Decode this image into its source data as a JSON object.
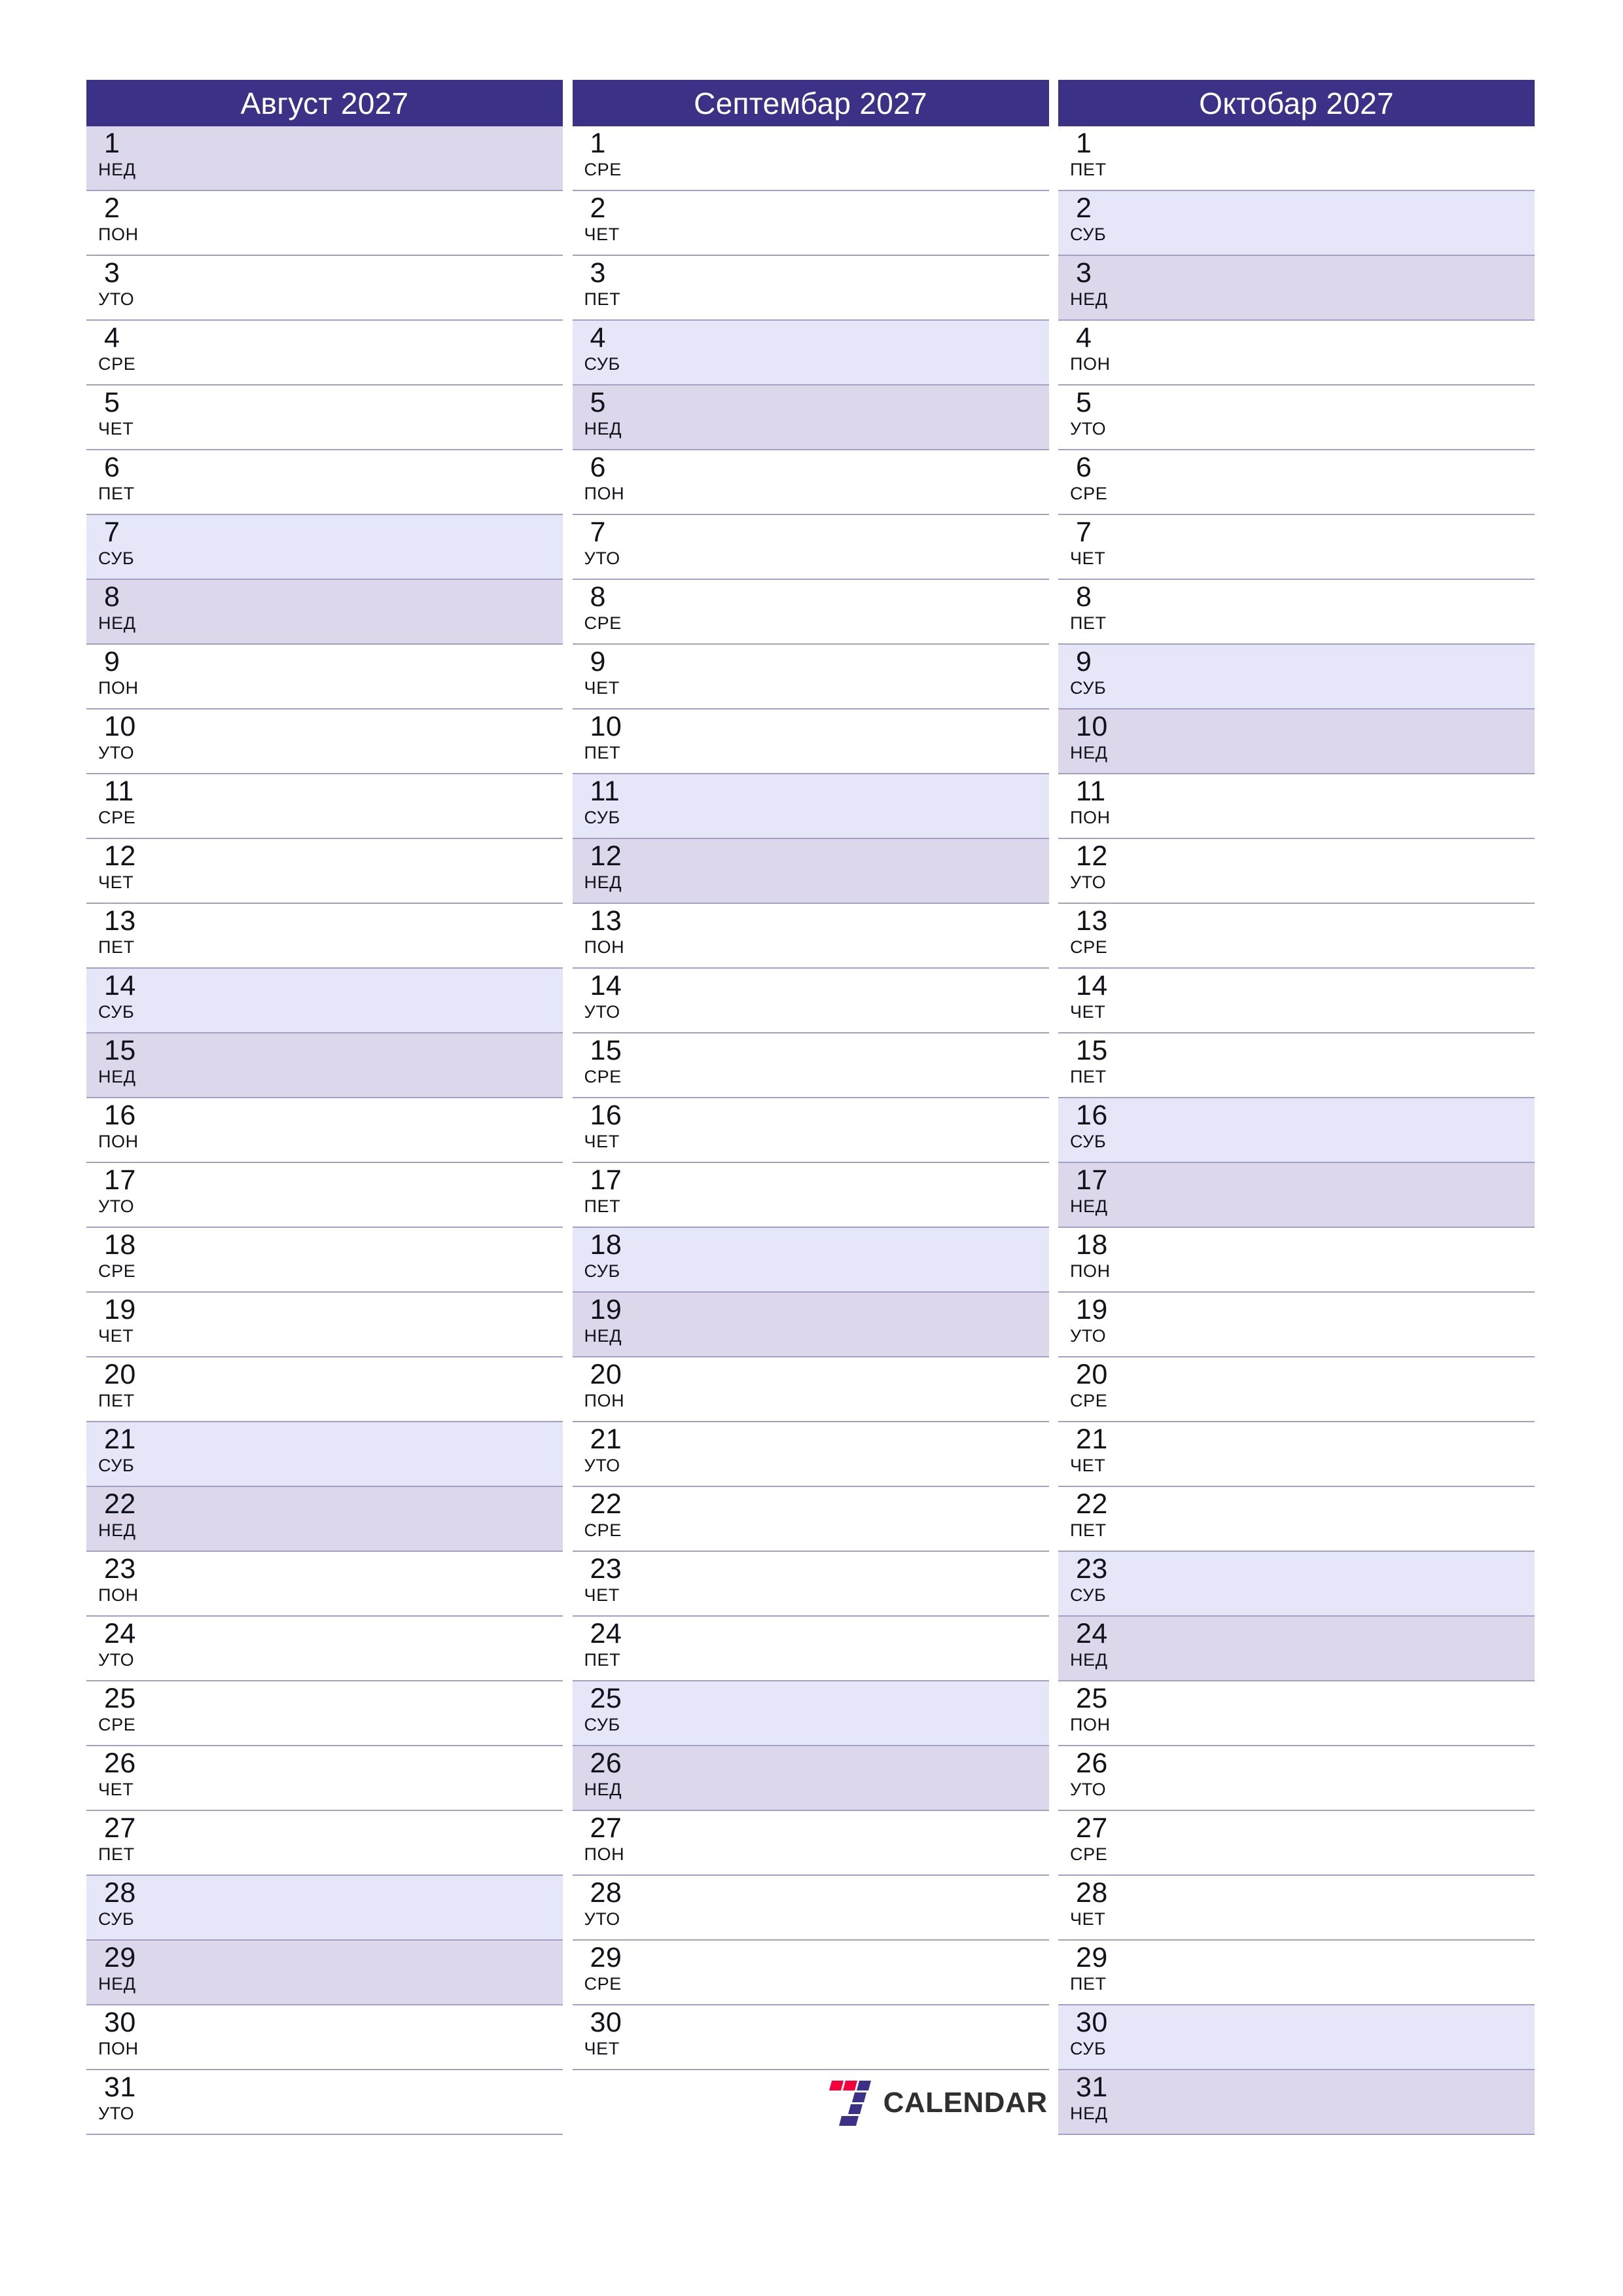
{
  "colors": {
    "header_bg": "#3b3287",
    "header_text": "#ffffff",
    "saturday_bg": "#e5e7f8",
    "sunday_bg": "#dcd7ea",
    "row_line": "#a3a0c4",
    "logo_red": "#f5003c",
    "logo_purple": "#3b3287",
    "logo_text": "#2f2f2f",
    "page_bg": "#ffffff"
  },
  "brand": {
    "name": "CALENDAR",
    "mark": "seven-logo-icon"
  },
  "weekday_names": {
    "mon": "ПОН",
    "tue": "УТО",
    "wed": "СРЕ",
    "thu": "ЧЕТ",
    "fri": "ПЕТ",
    "sat": "СУБ",
    "sun": "НЕД"
  },
  "months": [
    {
      "title": "Август 2027",
      "month_name": "Август",
      "year": "2027",
      "days": [
        {
          "n": "1",
          "wd": "НЕД",
          "type": "sun"
        },
        {
          "n": "2",
          "wd": "ПОН",
          "type": "wd"
        },
        {
          "n": "3",
          "wd": "УТО",
          "type": "wd"
        },
        {
          "n": "4",
          "wd": "СРЕ",
          "type": "wd"
        },
        {
          "n": "5",
          "wd": "ЧЕТ",
          "type": "wd"
        },
        {
          "n": "6",
          "wd": "ПЕТ",
          "type": "wd"
        },
        {
          "n": "7",
          "wd": "СУБ",
          "type": "sat"
        },
        {
          "n": "8",
          "wd": "НЕД",
          "type": "sun"
        },
        {
          "n": "9",
          "wd": "ПОН",
          "type": "wd"
        },
        {
          "n": "10",
          "wd": "УТО",
          "type": "wd"
        },
        {
          "n": "11",
          "wd": "СРЕ",
          "type": "wd"
        },
        {
          "n": "12",
          "wd": "ЧЕТ",
          "type": "wd"
        },
        {
          "n": "13",
          "wd": "ПЕТ",
          "type": "wd"
        },
        {
          "n": "14",
          "wd": "СУБ",
          "type": "sat"
        },
        {
          "n": "15",
          "wd": "НЕД",
          "type": "sun"
        },
        {
          "n": "16",
          "wd": "ПОН",
          "type": "wd"
        },
        {
          "n": "17",
          "wd": "УТО",
          "type": "wd"
        },
        {
          "n": "18",
          "wd": "СРЕ",
          "type": "wd"
        },
        {
          "n": "19",
          "wd": "ЧЕТ",
          "type": "wd"
        },
        {
          "n": "20",
          "wd": "ПЕТ",
          "type": "wd"
        },
        {
          "n": "21",
          "wd": "СУБ",
          "type": "sat"
        },
        {
          "n": "22",
          "wd": "НЕД",
          "type": "sun"
        },
        {
          "n": "23",
          "wd": "ПОН",
          "type": "wd"
        },
        {
          "n": "24",
          "wd": "УТО",
          "type": "wd"
        },
        {
          "n": "25",
          "wd": "СРЕ",
          "type": "wd"
        },
        {
          "n": "26",
          "wd": "ЧЕТ",
          "type": "wd"
        },
        {
          "n": "27",
          "wd": "ПЕТ",
          "type": "wd"
        },
        {
          "n": "28",
          "wd": "СУБ",
          "type": "sat"
        },
        {
          "n": "29",
          "wd": "НЕД",
          "type": "sun"
        },
        {
          "n": "30",
          "wd": "ПОН",
          "type": "wd"
        },
        {
          "n": "31",
          "wd": "УТО",
          "type": "wd"
        }
      ]
    },
    {
      "title": "Септембар 2027",
      "month_name": "Септембар",
      "year": "2027",
      "days": [
        {
          "n": "1",
          "wd": "СРЕ",
          "type": "wd"
        },
        {
          "n": "2",
          "wd": "ЧЕТ",
          "type": "wd"
        },
        {
          "n": "3",
          "wd": "ПЕТ",
          "type": "wd"
        },
        {
          "n": "4",
          "wd": "СУБ",
          "type": "sat"
        },
        {
          "n": "5",
          "wd": "НЕД",
          "type": "sun"
        },
        {
          "n": "6",
          "wd": "ПОН",
          "type": "wd"
        },
        {
          "n": "7",
          "wd": "УТО",
          "type": "wd"
        },
        {
          "n": "8",
          "wd": "СРЕ",
          "type": "wd"
        },
        {
          "n": "9",
          "wd": "ЧЕТ",
          "type": "wd"
        },
        {
          "n": "10",
          "wd": "ПЕТ",
          "type": "wd"
        },
        {
          "n": "11",
          "wd": "СУБ",
          "type": "sat"
        },
        {
          "n": "12",
          "wd": "НЕД",
          "type": "sun"
        },
        {
          "n": "13",
          "wd": "ПОН",
          "type": "wd"
        },
        {
          "n": "14",
          "wd": "УТО",
          "type": "wd"
        },
        {
          "n": "15",
          "wd": "СРЕ",
          "type": "wd"
        },
        {
          "n": "16",
          "wd": "ЧЕТ",
          "type": "wd"
        },
        {
          "n": "17",
          "wd": "ПЕТ",
          "type": "wd"
        },
        {
          "n": "18",
          "wd": "СУБ",
          "type": "sat"
        },
        {
          "n": "19",
          "wd": "НЕД",
          "type": "sun"
        },
        {
          "n": "20",
          "wd": "ПОН",
          "type": "wd"
        },
        {
          "n": "21",
          "wd": "УТО",
          "type": "wd"
        },
        {
          "n": "22",
          "wd": "СРЕ",
          "type": "wd"
        },
        {
          "n": "23",
          "wd": "ЧЕТ",
          "type": "wd"
        },
        {
          "n": "24",
          "wd": "ПЕТ",
          "type": "wd"
        },
        {
          "n": "25",
          "wd": "СУБ",
          "type": "sat"
        },
        {
          "n": "26",
          "wd": "НЕД",
          "type": "sun"
        },
        {
          "n": "27",
          "wd": "ПОН",
          "type": "wd"
        },
        {
          "n": "28",
          "wd": "УТО",
          "type": "wd"
        },
        {
          "n": "29",
          "wd": "СРЕ",
          "type": "wd"
        },
        {
          "n": "30",
          "wd": "ЧЕТ",
          "type": "wd"
        }
      ]
    },
    {
      "title": "Октобар 2027",
      "month_name": "Октобар",
      "year": "2027",
      "days": [
        {
          "n": "1",
          "wd": "ПЕТ",
          "type": "wd"
        },
        {
          "n": "2",
          "wd": "СУБ",
          "type": "sat"
        },
        {
          "n": "3",
          "wd": "НЕД",
          "type": "sun"
        },
        {
          "n": "4",
          "wd": "ПОН",
          "type": "wd"
        },
        {
          "n": "5",
          "wd": "УТО",
          "type": "wd"
        },
        {
          "n": "6",
          "wd": "СРЕ",
          "type": "wd"
        },
        {
          "n": "7",
          "wd": "ЧЕТ",
          "type": "wd"
        },
        {
          "n": "8",
          "wd": "ПЕТ",
          "type": "wd"
        },
        {
          "n": "9",
          "wd": "СУБ",
          "type": "sat"
        },
        {
          "n": "10",
          "wd": "НЕД",
          "type": "sun"
        },
        {
          "n": "11",
          "wd": "ПОН",
          "type": "wd"
        },
        {
          "n": "12",
          "wd": "УТО",
          "type": "wd"
        },
        {
          "n": "13",
          "wd": "СРЕ",
          "type": "wd"
        },
        {
          "n": "14",
          "wd": "ЧЕТ",
          "type": "wd"
        },
        {
          "n": "15",
          "wd": "ПЕТ",
          "type": "wd"
        },
        {
          "n": "16",
          "wd": "СУБ",
          "type": "sat"
        },
        {
          "n": "17",
          "wd": "НЕД",
          "type": "sun"
        },
        {
          "n": "18",
          "wd": "ПОН",
          "type": "wd"
        },
        {
          "n": "19",
          "wd": "УТО",
          "type": "wd"
        },
        {
          "n": "20",
          "wd": "СРЕ",
          "type": "wd"
        },
        {
          "n": "21",
          "wd": "ЧЕТ",
          "type": "wd"
        },
        {
          "n": "22",
          "wd": "ПЕТ",
          "type": "wd"
        },
        {
          "n": "23",
          "wd": "СУБ",
          "type": "sat"
        },
        {
          "n": "24",
          "wd": "НЕД",
          "type": "sun"
        },
        {
          "n": "25",
          "wd": "ПОН",
          "type": "wd"
        },
        {
          "n": "26",
          "wd": "УТО",
          "type": "wd"
        },
        {
          "n": "27",
          "wd": "СРЕ",
          "type": "wd"
        },
        {
          "n": "28",
          "wd": "ЧЕТ",
          "type": "wd"
        },
        {
          "n": "29",
          "wd": "ПЕТ",
          "type": "wd"
        },
        {
          "n": "30",
          "wd": "СУБ",
          "type": "sat"
        },
        {
          "n": "31",
          "wd": "НЕД",
          "type": "sun"
        }
      ]
    }
  ]
}
